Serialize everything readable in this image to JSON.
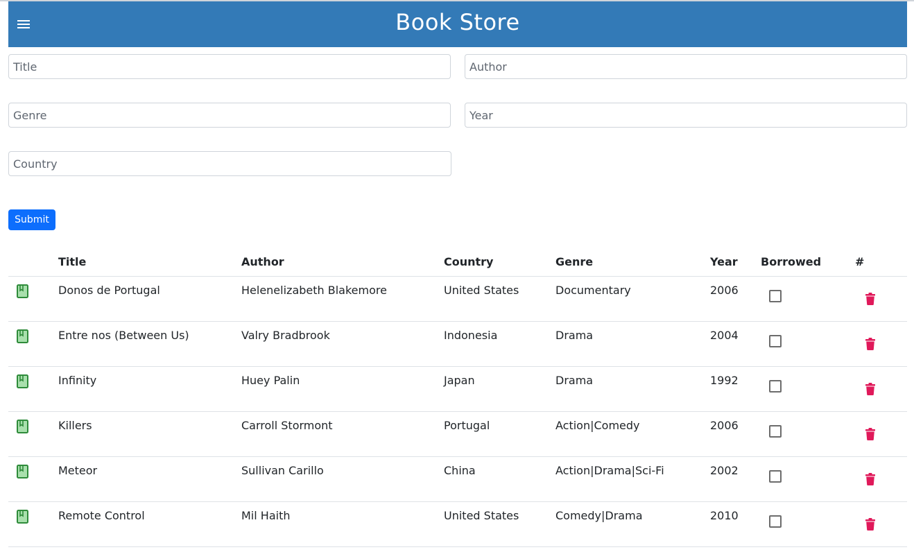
{
  "app": {
    "title": "Book Store",
    "brand_color": "#337ab7"
  },
  "form": {
    "title_placeholder": "Title",
    "author_placeholder": "Author",
    "genre_placeholder": "Genre",
    "year_placeholder": "Year",
    "country_placeholder": "Country",
    "title_value": "",
    "author_value": "",
    "genre_value": "",
    "year_value": "",
    "country_value": "",
    "submit_label": "Submit"
  },
  "table": {
    "headers": {
      "icon": "",
      "title": "Title",
      "author": "Author",
      "country": "Country",
      "genre": "Genre",
      "year": "Year",
      "borrowed": "Borrowed",
      "actions": "#"
    },
    "rows": [
      {
        "title": "Donos de Portugal",
        "author": "Helenelizabeth Blakemore",
        "country": "United States",
        "genre": "Documentary",
        "year": "2006",
        "borrowed": false
      },
      {
        "title": "Entre nos (Between Us)",
        "author": "Valry Bradbrook",
        "country": "Indonesia",
        "genre": "Drama",
        "year": "2004",
        "borrowed": false
      },
      {
        "title": "Infinity",
        "author": "Huey Palin",
        "country": "Japan",
        "genre": "Drama",
        "year": "1992",
        "borrowed": false
      },
      {
        "title": "Killers",
        "author": "Carroll Stormont",
        "country": "Portugal",
        "genre": "Action|Comedy",
        "year": "2006",
        "borrowed": false
      },
      {
        "title": "Meteor",
        "author": "Sullivan Carillo",
        "country": "China",
        "genre": "Action|Drama|Sci-Fi",
        "year": "2002",
        "borrowed": false
      },
      {
        "title": "Remote Control",
        "author": "Mil Haith",
        "country": "United States",
        "genre": "Comedy|Drama",
        "year": "2010",
        "borrowed": false
      }
    ]
  },
  "icons": {
    "menu": "hamburger-icon",
    "book": "book-icon",
    "delete": "trash-icon",
    "book_color": "#2e8b3a",
    "delete_color": "#e0195a"
  }
}
